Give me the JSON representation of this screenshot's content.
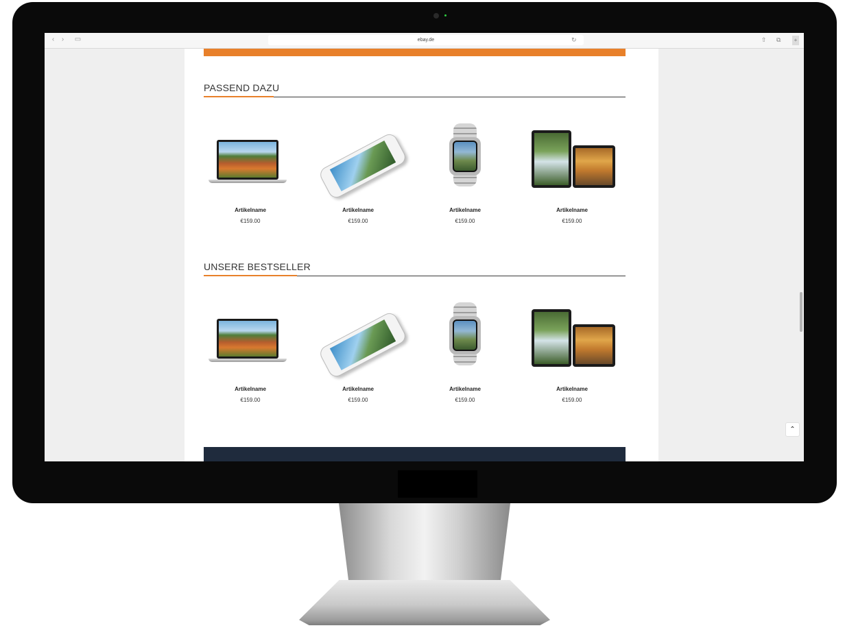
{
  "browser": {
    "url": "ebay.de",
    "back_glyph": "‹",
    "forward_glyph": "›",
    "sidebar_glyph": "▭",
    "reload_glyph": "↻",
    "share_glyph": "⇧",
    "tabs_glyph": "⧉",
    "new_tab_glyph": "+"
  },
  "sections": [
    {
      "title": "PASSEND DAZU",
      "products": [
        {
          "name": "Artikelname",
          "price": "€159.00",
          "image": "macbook"
        },
        {
          "name": "Artikelname",
          "price": "€159.00",
          "image": "iphone"
        },
        {
          "name": "Artikelname",
          "price": "€159.00",
          "image": "apple-watch"
        },
        {
          "name": "Artikelname",
          "price": "€159.00",
          "image": "ipad"
        }
      ]
    },
    {
      "title": "UNSERE BESTSELLER",
      "products": [
        {
          "name": "Artikelname",
          "price": "€159.00",
          "image": "macbook"
        },
        {
          "name": "Artikelname",
          "price": "€159.00",
          "image": "iphone"
        },
        {
          "name": "Artikelname",
          "price": "€159.00",
          "image": "apple-watch"
        },
        {
          "name": "Artikelname",
          "price": "€159.00",
          "image": "ipad"
        }
      ]
    }
  ],
  "back_to_top_glyph": "⌃",
  "colors": {
    "accent": "#e8802a",
    "footer": "#1f2b3d"
  }
}
